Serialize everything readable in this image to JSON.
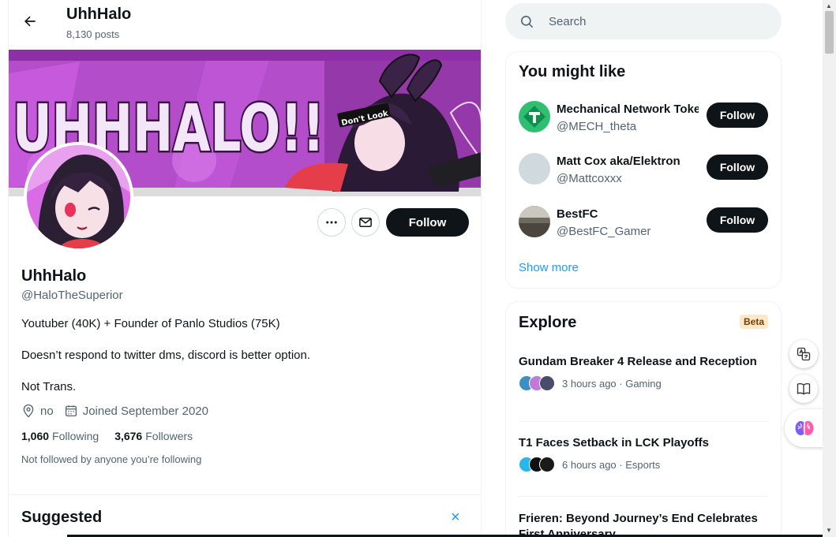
{
  "header": {
    "name": "UhhHalo",
    "posts_count": "8,130 posts"
  },
  "banner": {
    "text": "UHHHALO!!",
    "sticker_text": "Don't Look"
  },
  "profile": {
    "display_name": "UhhHalo",
    "handle": "@HaloTheSuperior",
    "bio_lines": [
      "Youtuber (40K) + Founder of Panlo Studios (75K)",
      "Doesn’t respond to twitter dms, discord is better option.",
      "Not Trans."
    ],
    "location": "no",
    "joined": "Joined September 2020",
    "following_count": "1,060",
    "following_label": "Following",
    "followers_count": "3,676",
    "followers_label": "Followers",
    "not_followed_note": "Not followed by anyone you’re following",
    "follow_label": "Follow"
  },
  "suggested": {
    "title": "Suggested",
    "close_icon": "×"
  },
  "search": {
    "placeholder": "Search"
  },
  "who_to_follow": {
    "title": "You might like",
    "users": [
      {
        "name": "Mechanical Network Toke",
        "handle": "@MECH_theta",
        "button": "Follow"
      },
      {
        "name": "Matt Cox aka/Elektron",
        "handle": "@Mattcoxxx",
        "button": "Follow"
      },
      {
        "name": "BestFC",
        "handle": "@BestFC_Gamer",
        "button": "Follow"
      }
    ],
    "show_more": "Show more"
  },
  "explore": {
    "title": "Explore",
    "badge": "Beta",
    "trends": [
      {
        "title": "Gundam Breaker 4 Release and Reception",
        "meta": "3 hours ago · Gaming"
      },
      {
        "title": "T1 Faces Setback in LCK Playoffs",
        "meta": "6 hours ago · Esports"
      },
      {
        "title": "Frieren: Beyond Journey’s End Celebrates First Anniversary",
        "meta": ""
      }
    ]
  },
  "colors": {
    "accent": "#1d9bf0",
    "dark_button": "#0f1419",
    "muted_text": "#536471",
    "banner_purple": "#c64fd8"
  },
  "icons": {
    "back": "arrow-left-icon",
    "more": "more-icon",
    "message": "mail-icon",
    "location": "location-icon",
    "calendar": "calendar-icon",
    "search": "search-icon",
    "translate": "translate-icon",
    "reader": "reader-icon",
    "brain": "brain-icon"
  }
}
